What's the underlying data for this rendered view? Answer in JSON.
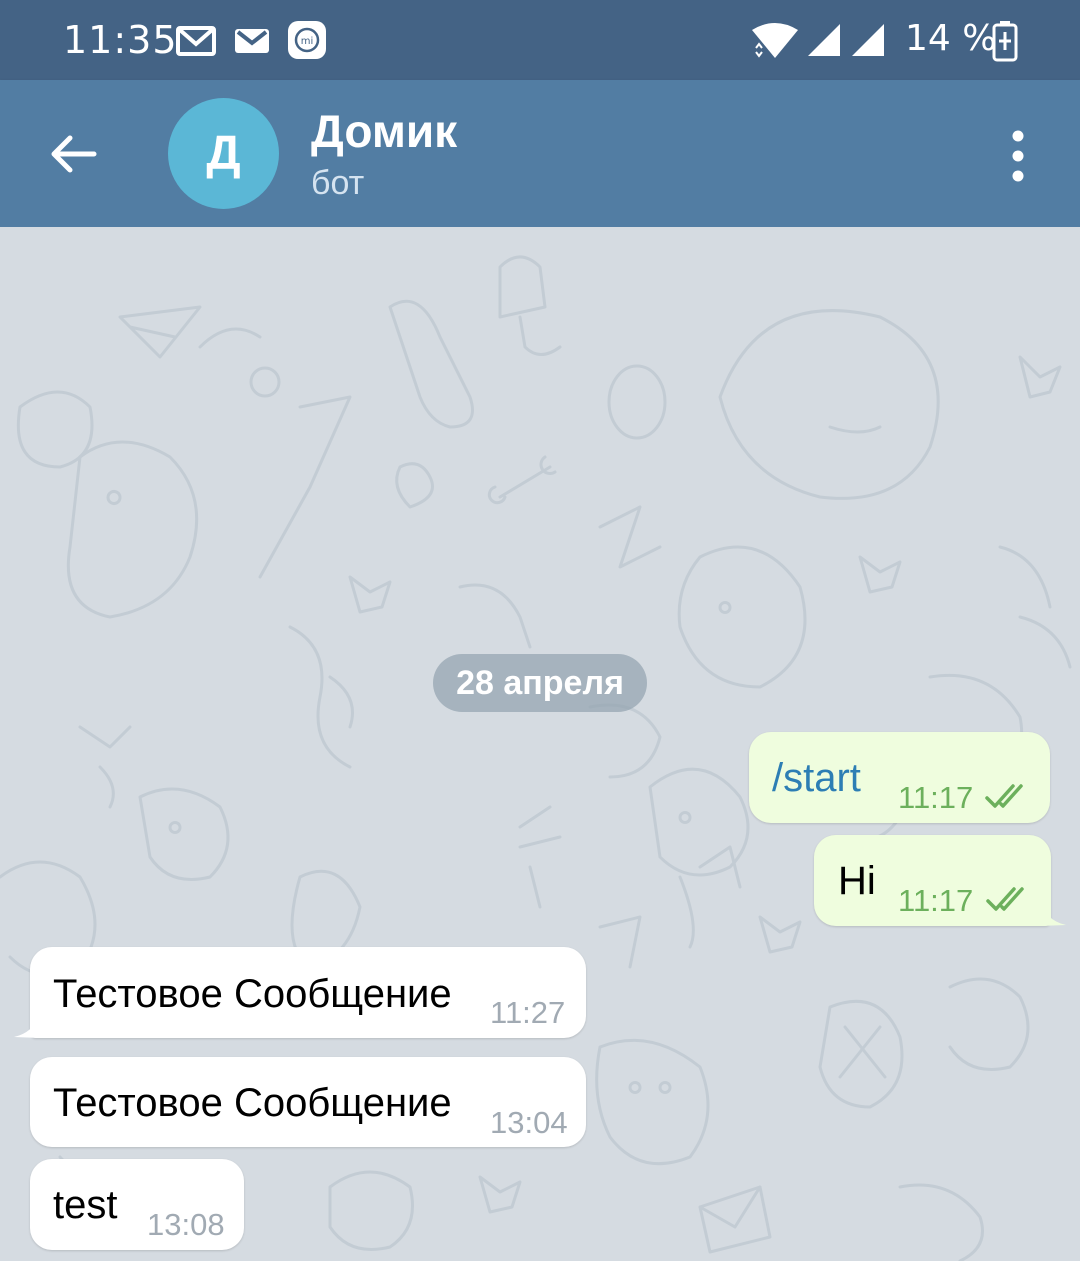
{
  "status_bar": {
    "time": "11:35",
    "battery_percent": "14 %",
    "icons": [
      "gmail-icon",
      "mail-icon",
      "mi-icon",
      "wifi-icon",
      "signal-icon",
      "signal-icon",
      "battery-charging-icon"
    ]
  },
  "header": {
    "avatar_letter": "Д",
    "title": "Домик",
    "subtitle": "бот",
    "avatar_color": "#5bb7d6",
    "bar_color": "#527da3"
  },
  "chat": {
    "date_label": "28 апреля",
    "messages": [
      {
        "direction": "out",
        "text": "/start",
        "time": "11:17",
        "read": true
      },
      {
        "direction": "out",
        "text": "Hi",
        "time": "11:17",
        "read": true
      },
      {
        "direction": "in",
        "text": "Тестовое Сообщение",
        "time": "11:27"
      },
      {
        "direction": "in",
        "text": "Тестовое Сообщение",
        "time": "13:04"
      },
      {
        "direction": "in",
        "text": "test",
        "time": "13:08"
      }
    ]
  }
}
